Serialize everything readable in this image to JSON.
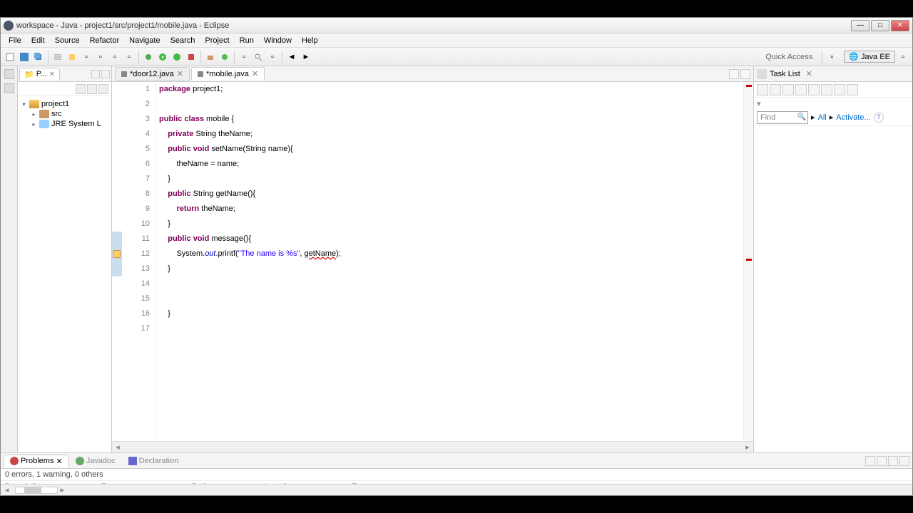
{
  "window": {
    "title": "workspace - Java - project1/src/project1/mobile.java - Eclipse"
  },
  "menus": [
    "File",
    "Edit",
    "Source",
    "Refactor",
    "Navigate",
    "Search",
    "Project",
    "Run",
    "Window",
    "Help"
  ],
  "quickaccess": "Quick Access",
  "perspective": "Java EE",
  "explorer": {
    "tab": "P...",
    "project": "project1",
    "src": "src",
    "jre": "JRE System L"
  },
  "editor": {
    "tabs": [
      {
        "label": "*door12.java",
        "active": false
      },
      {
        "label": "*mobile.java",
        "active": true
      }
    ]
  },
  "code": {
    "lines": [
      {
        "n": 1,
        "tokens": [
          [
            "kw",
            "package"
          ],
          [
            "",
            " project1;"
          ]
        ]
      },
      {
        "n": 2,
        "tokens": []
      },
      {
        "n": 3,
        "tokens": [
          [
            "kw",
            "public"
          ],
          [
            "",
            " "
          ],
          [
            "kw",
            "class"
          ],
          [
            "",
            " mobile {"
          ]
        ]
      },
      {
        "n": 4,
        "tokens": [
          [
            "",
            "    "
          ],
          [
            "kw",
            "private"
          ],
          [
            "",
            " String theName;"
          ]
        ]
      },
      {
        "n": 5,
        "tokens": [
          [
            "",
            "    "
          ],
          [
            "kw",
            "public"
          ],
          [
            "",
            " "
          ],
          [
            "kw",
            "void"
          ],
          [
            "",
            " setName(String name){"
          ]
        ]
      },
      {
        "n": 6,
        "tokens": [
          [
            "",
            "        theName = name;"
          ]
        ]
      },
      {
        "n": 7,
        "tokens": [
          [
            "",
            "    }"
          ]
        ]
      },
      {
        "n": 8,
        "tokens": [
          [
            "",
            "    "
          ],
          [
            "kw",
            "public"
          ],
          [
            "",
            " String getName(){"
          ]
        ]
      },
      {
        "n": 9,
        "tokens": [
          [
            "",
            "        "
          ],
          [
            "kw",
            "return"
          ],
          [
            "",
            " theName;"
          ]
        ]
      },
      {
        "n": 10,
        "tokens": [
          [
            "",
            "    }"
          ]
        ]
      },
      {
        "n": 11,
        "tokens": [
          [
            "",
            "    "
          ],
          [
            "kw",
            "public"
          ],
          [
            "",
            " "
          ],
          [
            "kw",
            "void"
          ],
          [
            "",
            " message(){"
          ]
        ]
      },
      {
        "n": 12,
        "tokens": [
          [
            "",
            "        System."
          ],
          [
            "fld",
            "out"
          ],
          [
            "",
            ".printf("
          ],
          [
            "str",
            "\"The name is %s\""
          ],
          [
            "",
            ", "
          ],
          [
            "err",
            "getName"
          ],
          [
            "",
            ");"
          ]
        ]
      },
      {
        "n": 13,
        "tokens": [
          [
            "",
            "    }"
          ]
        ]
      },
      {
        "n": 14,
        "tokens": []
      },
      {
        "n": 15,
        "tokens": []
      },
      {
        "n": 16,
        "tokens": [
          [
            "",
            "    }"
          ]
        ]
      },
      {
        "n": 17,
        "tokens": []
      }
    ]
  },
  "tasklist": {
    "title": "Task List",
    "find": "Find",
    "all": "All",
    "activate": "Activate..."
  },
  "problems": {
    "tabs": [
      "Problems",
      "Javadoc",
      "Declaration"
    ],
    "status": "0 errors, 1 warning, 0 others",
    "cols": [
      "Description",
      "Resource",
      "Path",
      "Location",
      "Type"
    ]
  }
}
